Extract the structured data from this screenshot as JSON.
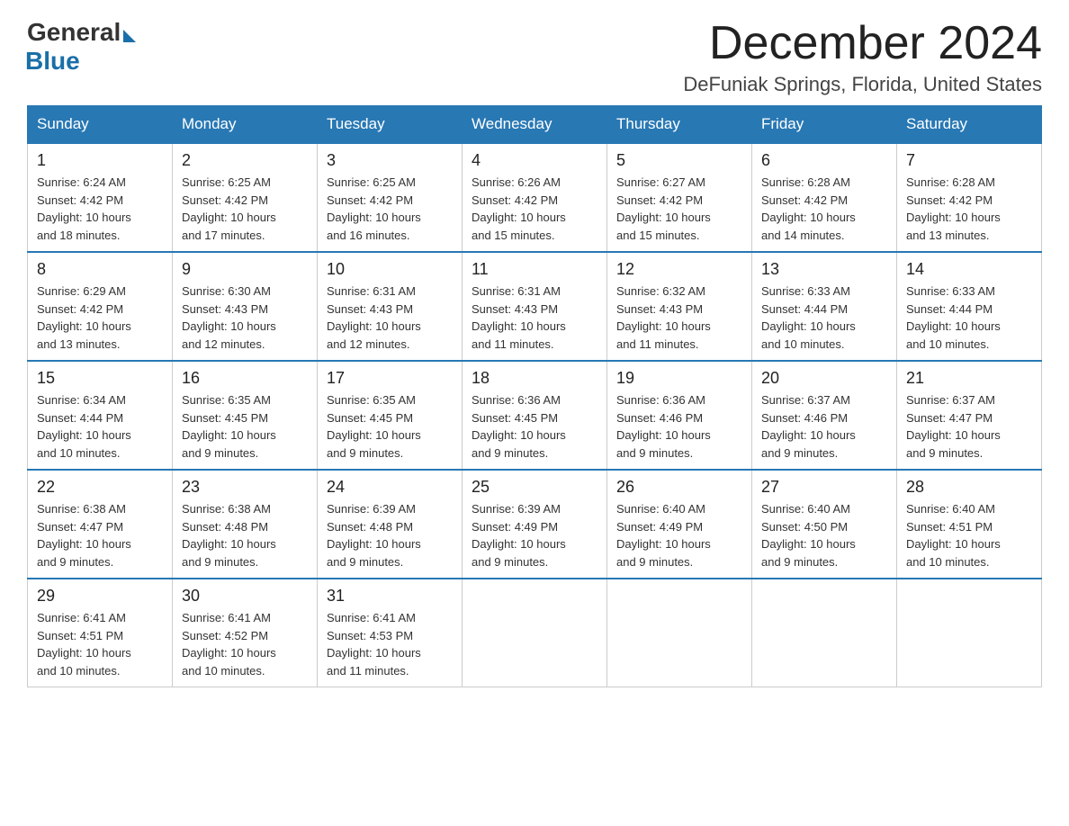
{
  "logo": {
    "general": "General",
    "blue": "Blue"
  },
  "title": "December 2024",
  "location": "DeFuniak Springs, Florida, United States",
  "days_of_week": [
    "Sunday",
    "Monday",
    "Tuesday",
    "Wednesday",
    "Thursday",
    "Friday",
    "Saturday"
  ],
  "weeks": [
    [
      {
        "day": "1",
        "sunrise": "6:24 AM",
        "sunset": "4:42 PM",
        "daylight": "10 hours and 18 minutes."
      },
      {
        "day": "2",
        "sunrise": "6:25 AM",
        "sunset": "4:42 PM",
        "daylight": "10 hours and 17 minutes."
      },
      {
        "day": "3",
        "sunrise": "6:25 AM",
        "sunset": "4:42 PM",
        "daylight": "10 hours and 16 minutes."
      },
      {
        "day": "4",
        "sunrise": "6:26 AM",
        "sunset": "4:42 PM",
        "daylight": "10 hours and 15 minutes."
      },
      {
        "day": "5",
        "sunrise": "6:27 AM",
        "sunset": "4:42 PM",
        "daylight": "10 hours and 15 minutes."
      },
      {
        "day": "6",
        "sunrise": "6:28 AM",
        "sunset": "4:42 PM",
        "daylight": "10 hours and 14 minutes."
      },
      {
        "day": "7",
        "sunrise": "6:28 AM",
        "sunset": "4:42 PM",
        "daylight": "10 hours and 13 minutes."
      }
    ],
    [
      {
        "day": "8",
        "sunrise": "6:29 AM",
        "sunset": "4:42 PM",
        "daylight": "10 hours and 13 minutes."
      },
      {
        "day": "9",
        "sunrise": "6:30 AM",
        "sunset": "4:43 PM",
        "daylight": "10 hours and 12 minutes."
      },
      {
        "day": "10",
        "sunrise": "6:31 AM",
        "sunset": "4:43 PM",
        "daylight": "10 hours and 12 minutes."
      },
      {
        "day": "11",
        "sunrise": "6:31 AM",
        "sunset": "4:43 PM",
        "daylight": "10 hours and 11 minutes."
      },
      {
        "day": "12",
        "sunrise": "6:32 AM",
        "sunset": "4:43 PM",
        "daylight": "10 hours and 11 minutes."
      },
      {
        "day": "13",
        "sunrise": "6:33 AM",
        "sunset": "4:44 PM",
        "daylight": "10 hours and 10 minutes."
      },
      {
        "day": "14",
        "sunrise": "6:33 AM",
        "sunset": "4:44 PM",
        "daylight": "10 hours and 10 minutes."
      }
    ],
    [
      {
        "day": "15",
        "sunrise": "6:34 AM",
        "sunset": "4:44 PM",
        "daylight": "10 hours and 10 minutes."
      },
      {
        "day": "16",
        "sunrise": "6:35 AM",
        "sunset": "4:45 PM",
        "daylight": "10 hours and 9 minutes."
      },
      {
        "day": "17",
        "sunrise": "6:35 AM",
        "sunset": "4:45 PM",
        "daylight": "10 hours and 9 minutes."
      },
      {
        "day": "18",
        "sunrise": "6:36 AM",
        "sunset": "4:45 PM",
        "daylight": "10 hours and 9 minutes."
      },
      {
        "day": "19",
        "sunrise": "6:36 AM",
        "sunset": "4:46 PM",
        "daylight": "10 hours and 9 minutes."
      },
      {
        "day": "20",
        "sunrise": "6:37 AM",
        "sunset": "4:46 PM",
        "daylight": "10 hours and 9 minutes."
      },
      {
        "day": "21",
        "sunrise": "6:37 AM",
        "sunset": "4:47 PM",
        "daylight": "10 hours and 9 minutes."
      }
    ],
    [
      {
        "day": "22",
        "sunrise": "6:38 AM",
        "sunset": "4:47 PM",
        "daylight": "10 hours and 9 minutes."
      },
      {
        "day": "23",
        "sunrise": "6:38 AM",
        "sunset": "4:48 PM",
        "daylight": "10 hours and 9 minutes."
      },
      {
        "day": "24",
        "sunrise": "6:39 AM",
        "sunset": "4:48 PM",
        "daylight": "10 hours and 9 minutes."
      },
      {
        "day": "25",
        "sunrise": "6:39 AM",
        "sunset": "4:49 PM",
        "daylight": "10 hours and 9 minutes."
      },
      {
        "day": "26",
        "sunrise": "6:40 AM",
        "sunset": "4:49 PM",
        "daylight": "10 hours and 9 minutes."
      },
      {
        "day": "27",
        "sunrise": "6:40 AM",
        "sunset": "4:50 PM",
        "daylight": "10 hours and 9 minutes."
      },
      {
        "day": "28",
        "sunrise": "6:40 AM",
        "sunset": "4:51 PM",
        "daylight": "10 hours and 10 minutes."
      }
    ],
    [
      {
        "day": "29",
        "sunrise": "6:41 AM",
        "sunset": "4:51 PM",
        "daylight": "10 hours and 10 minutes."
      },
      {
        "day": "30",
        "sunrise": "6:41 AM",
        "sunset": "4:52 PM",
        "daylight": "10 hours and 10 minutes."
      },
      {
        "day": "31",
        "sunrise": "6:41 AM",
        "sunset": "4:53 PM",
        "daylight": "10 hours and 11 minutes."
      },
      null,
      null,
      null,
      null
    ]
  ],
  "labels": {
    "sunrise": "Sunrise:",
    "sunset": "Sunset:",
    "daylight": "Daylight:"
  }
}
